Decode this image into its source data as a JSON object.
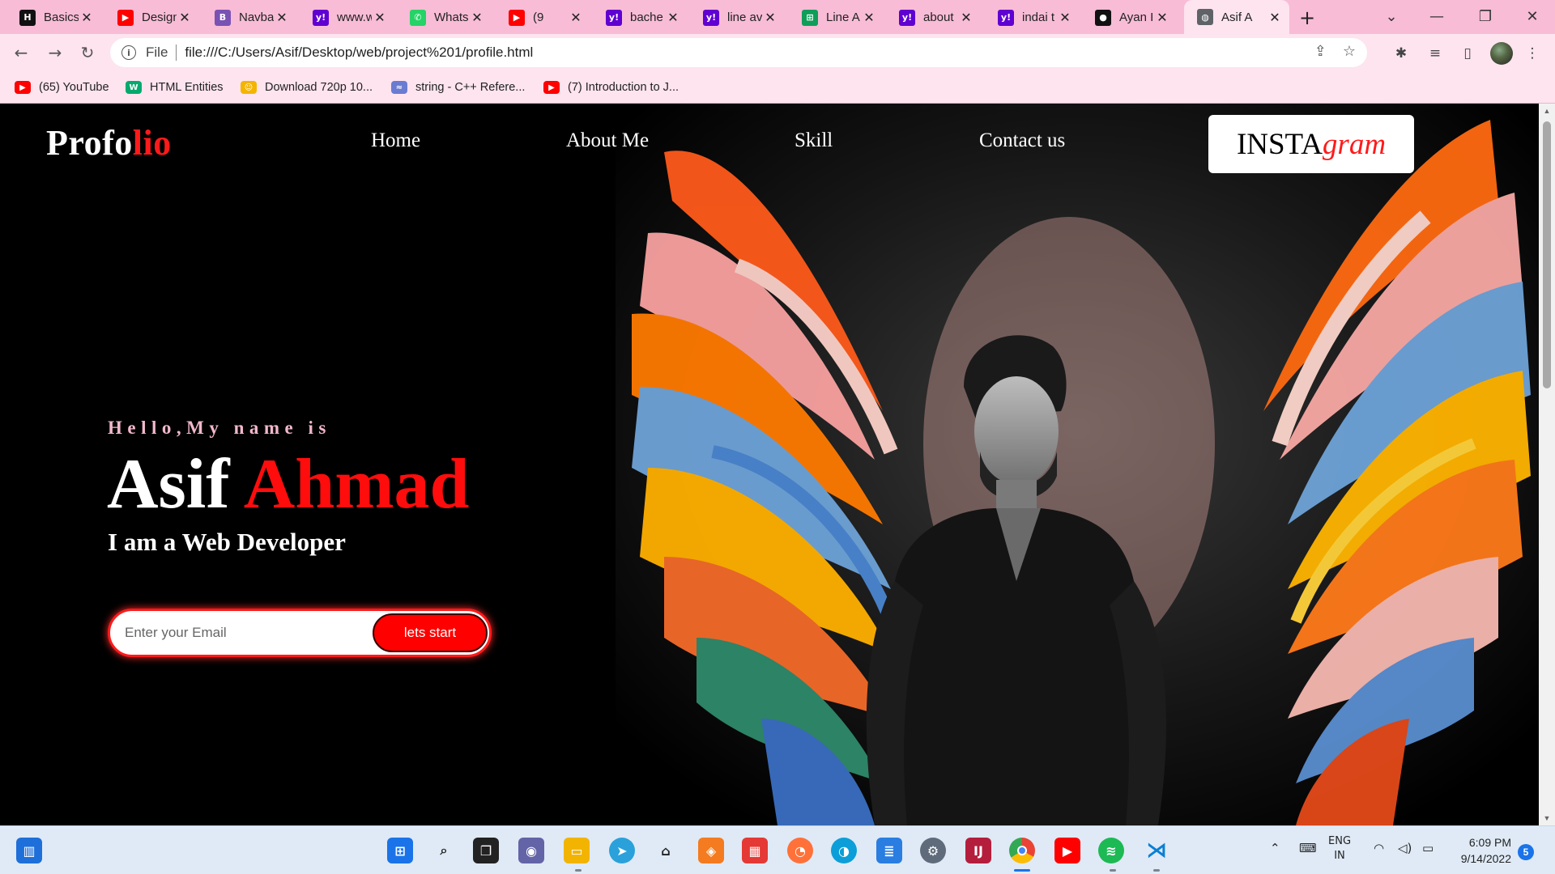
{
  "browser": {
    "tabs": [
      {
        "title": "Basics",
        "favicon": "hb-icon",
        "color": "#111111",
        "glyph": "H"
      },
      {
        "title": "Design",
        "favicon": "youtube-icon",
        "color": "#ff0000",
        "glyph": "▶"
      },
      {
        "title": "Navba",
        "favicon": "bootstrap-icon",
        "color": "#7952b3",
        "glyph": "B"
      },
      {
        "title": "www.w",
        "favicon": "yahoo-icon",
        "color": "#6001d2",
        "glyph": "y!"
      },
      {
        "title": "Whats",
        "favicon": "whatsapp-icon",
        "color": "#25d366",
        "glyph": "✆"
      },
      {
        "title": "(9",
        "favicon": "youtube-icon",
        "color": "#ff0000",
        "glyph": "▶"
      },
      {
        "title": "bache",
        "favicon": "yahoo-icon",
        "color": "#6001d2",
        "glyph": "y!"
      },
      {
        "title": "line av",
        "favicon": "yahoo-icon",
        "color": "#6001d2",
        "glyph": "y!"
      },
      {
        "title": "Line A",
        "favicon": "sheets-icon",
        "color": "#0f9d58",
        "glyph": "⊞"
      },
      {
        "title": "about",
        "favicon": "yahoo-icon",
        "color": "#6001d2",
        "glyph": "y!"
      },
      {
        "title": "indai t",
        "favicon": "yahoo-icon",
        "color": "#6001d2",
        "glyph": "y!"
      },
      {
        "title": "Ayan I",
        "favicon": "github-icon",
        "color": "#111111",
        "glyph": "●"
      },
      {
        "title": "Asif A",
        "favicon": "globe-icon",
        "color": "#5f6368",
        "glyph": "◍"
      }
    ],
    "url_scheme": "File",
    "url": "file:///C:/Users/Asif/Desktop/web/project%201/profile.html",
    "bookmarks": [
      {
        "label": "(65) YouTube",
        "icon": "youtube-icon",
        "color": "#ff0000",
        "glyph": "▶"
      },
      {
        "label": "HTML Entities",
        "icon": "w3-icon",
        "color": "#04aa6d",
        "glyph": "W"
      },
      {
        "label": "Download 720p 10...",
        "icon": "emoji-icon",
        "color": "#f4b400",
        "glyph": "☺"
      },
      {
        "label": "string - C++ Refere...",
        "icon": "cpp-icon",
        "color": "#6a7bd1",
        "glyph": "≈"
      },
      {
        "label": "(7) Introduction to J...",
        "icon": "youtube-icon",
        "color": "#ff0000",
        "glyph": "▶"
      }
    ]
  },
  "page": {
    "logo_main": "Profo",
    "logo_accent": "lio",
    "nav": [
      "Home",
      "About Me",
      "Skill",
      "Contact us"
    ],
    "insta_main": "INSTA",
    "insta_accent": "gram",
    "greeting": "Hello,My name is",
    "first_name": "Asif",
    "last_name": "Ahmad",
    "role": "I am a Web Developer",
    "email_placeholder": "Enter your Email",
    "cta_label": "lets start",
    "accent_color": "#ff0000"
  },
  "taskbar": {
    "language": "ENG",
    "region": "IN",
    "time": "6:09 PM",
    "date": "9/14/2022",
    "notifications": "5"
  }
}
